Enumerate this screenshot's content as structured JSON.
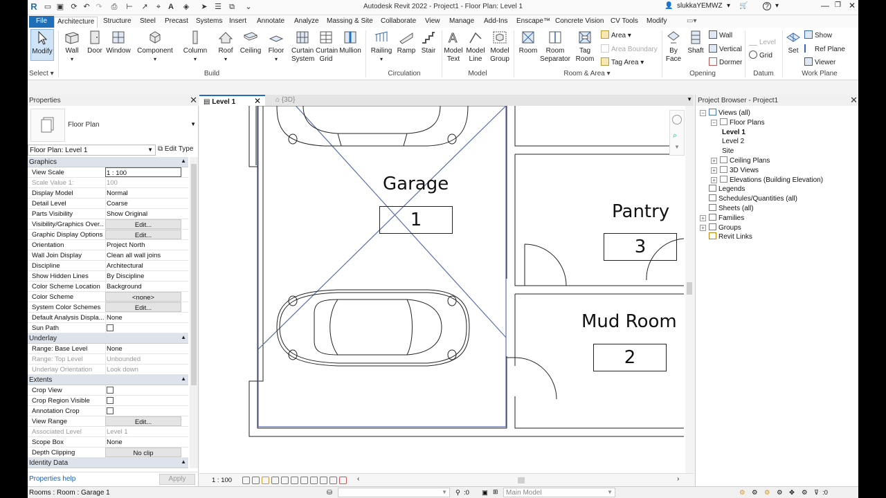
{
  "titlebar": {
    "title": "Autodesk Revit 2022 - Project1 - Floor Plan: Level 1",
    "user": "slukkaYEMWZ",
    "help": "?"
  },
  "tabs": [
    "File",
    "Architecture",
    "Structure",
    "Steel",
    "Precast",
    "Systems",
    "Insert",
    "Annotate",
    "Analyze",
    "Massing & Site",
    "Collaborate",
    "View",
    "Manage",
    "Add-Ins",
    "Enscape™",
    "Concrete Vision",
    "CV Tools",
    "Modify"
  ],
  "ribbon": {
    "select": {
      "modify": "Modify",
      "label": "Select"
    },
    "build": {
      "wall": "Wall",
      "door": "Door",
      "window": "Window",
      "component": "Component",
      "column": "Column",
      "roof": "Roof",
      "ceiling": "Ceiling",
      "floor": "Floor",
      "curtain_system": "Curtain System",
      "curtain_grid": "Curtain Grid",
      "mullion": "Mullion",
      "label": "Build"
    },
    "circulation": {
      "railing": "Railing",
      "ramp": "Ramp",
      "stair": "Stair",
      "label": "Circulation"
    },
    "model": {
      "model_text": "Model Text",
      "model_line": "Model Line",
      "model_group": "Model Group",
      "label": "Model"
    },
    "room_area": {
      "room": "Room",
      "room_separator": "Room Separator",
      "tag_room": "Tag Room",
      "area": "Area",
      "area_boundary": "Area Boundary",
      "tag_area": "Tag Area",
      "label": "Room & Area"
    },
    "opening": {
      "by_face": "By Face",
      "shaft": "Shaft",
      "wall": "Wall",
      "vertical": "Vertical",
      "dormer": "Dormer",
      "label": "Opening"
    },
    "datum": {
      "level": "Level",
      "grid": "Grid",
      "label": "Datum"
    },
    "work_plane": {
      "set": "Set",
      "show": "Show",
      "ref_plane": "Ref Plane",
      "viewer": "Viewer",
      "label": "Work Plane"
    }
  },
  "properties": {
    "title": "Properties",
    "type_name": "Floor Plan",
    "instance": "Floor Plan: Level 1",
    "edit_type": "Edit Type",
    "help": "Properties help",
    "apply": "Apply",
    "sections": [
      {
        "name": "Graphics",
        "rows": [
          {
            "k": "View Scale",
            "v": "1 : 100",
            "t": "sel"
          },
          {
            "k": "Scale Value    1:",
            "v": "100",
            "t": "dis"
          },
          {
            "k": "Display Model",
            "v": "Normal"
          },
          {
            "k": "Detail Level",
            "v": "Coarse"
          },
          {
            "k": "Parts Visibility",
            "v": "Show Original"
          },
          {
            "k": "Visibility/Graphics Over...",
            "v": "Edit...",
            "t": "btn"
          },
          {
            "k": "Graphic Display Options",
            "v": "Edit...",
            "t": "btn"
          },
          {
            "k": "Orientation",
            "v": "Project North"
          },
          {
            "k": "Wall Join Display",
            "v": "Clean all wall joins"
          },
          {
            "k": "Discipline",
            "v": "Architectural"
          },
          {
            "k": "Show Hidden Lines",
            "v": "By Discipline"
          },
          {
            "k": "Color Scheme Location",
            "v": "Background"
          },
          {
            "k": "Color Scheme",
            "v": "<none>",
            "t": "btn"
          },
          {
            "k": "System Color Schemes",
            "v": "Edit...",
            "t": "btn"
          },
          {
            "k": "Default Analysis Displa...",
            "v": "None"
          },
          {
            "k": "Sun Path",
            "v": "",
            "t": "cb"
          }
        ]
      },
      {
        "name": "Underlay",
        "rows": [
          {
            "k": "Range: Base Level",
            "v": "None"
          },
          {
            "k": "Range: Top Level",
            "v": "Unbounded",
            "t": "dis"
          },
          {
            "k": "Underlay Orientation",
            "v": "Look down",
            "t": "dis"
          }
        ]
      },
      {
        "name": "Extents",
        "rows": [
          {
            "k": "Crop View",
            "v": "",
            "t": "cb"
          },
          {
            "k": "Crop Region Visible",
            "v": "",
            "t": "cb"
          },
          {
            "k": "Annotation Crop",
            "v": "",
            "t": "cb"
          },
          {
            "k": "View Range",
            "v": "Edit...",
            "t": "btn"
          },
          {
            "k": "Associated Level",
            "v": "Level 1",
            "t": "dis"
          },
          {
            "k": "Scope Box",
            "v": "None"
          },
          {
            "k": "Depth Clipping",
            "v": "No clip",
            "t": "btn"
          }
        ]
      },
      {
        "name": "Identity Data",
        "rows": []
      }
    ]
  },
  "viewtabs": [
    {
      "label": "Level 1",
      "close": "✕"
    },
    {
      "label": "{3D}"
    }
  ],
  "rooms": [
    {
      "name": "Garage",
      "number": "1"
    },
    {
      "name": "Pantry",
      "number": "3"
    },
    {
      "name": "Mud Room",
      "number": "2"
    }
  ],
  "viewbar": {
    "scale": "1 : 100"
  },
  "browser": {
    "title": "Project Browser - Project1",
    "nodes": [
      {
        "label": "Views (all)",
        "level": 0,
        "ex": "−"
      },
      {
        "label": "Floor Plans",
        "level": 1,
        "ex": "−"
      },
      {
        "label": "Level 1",
        "level": 2,
        "bold": true
      },
      {
        "label": "Level 2",
        "level": 2
      },
      {
        "label": "Site",
        "level": 2
      },
      {
        "label": "Ceiling Plans",
        "level": 1,
        "ex": "+"
      },
      {
        "label": "3D Views",
        "level": 1,
        "ex": "+"
      },
      {
        "label": "Elevations (Building Elevation)",
        "level": 1,
        "ex": "+"
      },
      {
        "label": "Legends",
        "level": 0
      },
      {
        "label": "Schedules/Quantities (all)",
        "level": 0
      },
      {
        "label": "Sheets (all)",
        "level": 0
      },
      {
        "label": "Families",
        "level": 0,
        "ex": "+"
      },
      {
        "label": "Groups",
        "level": 0,
        "ex": "+"
      },
      {
        "label": "Revit Links",
        "level": 0
      }
    ]
  },
  "status": {
    "message": "Rooms : Room : Garage 1",
    "count": ":0",
    "model": "Main Model",
    "filter": ":0"
  },
  "colors": {
    "accent": "#1f6fb8",
    "crop": "#5a6fb0"
  }
}
